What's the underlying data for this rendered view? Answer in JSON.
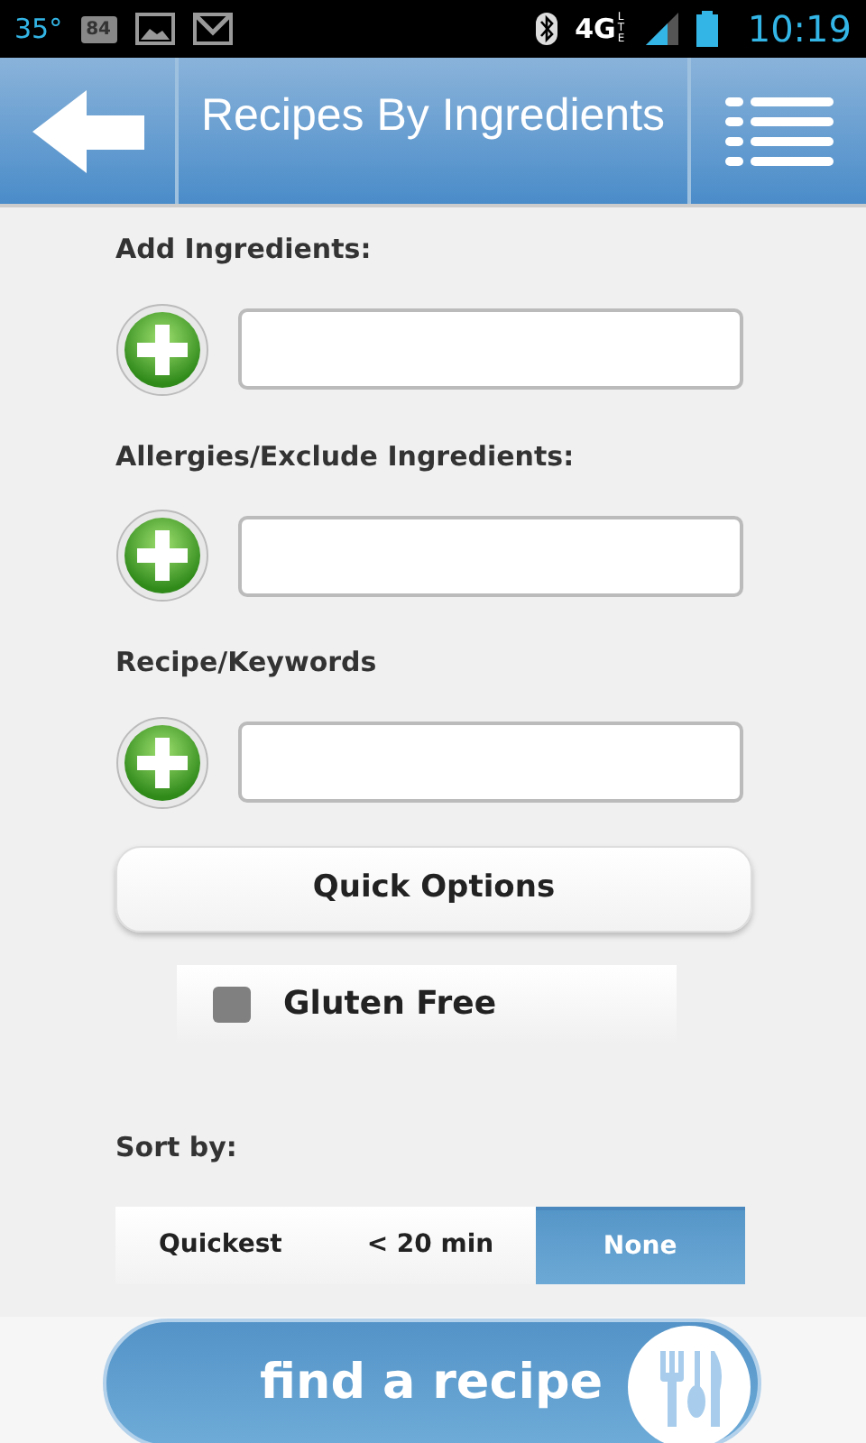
{
  "status_bar": {
    "temperature": "35°",
    "badge": "84",
    "network": "4G",
    "network_sub": "LTE",
    "time": "10:19"
  },
  "header": {
    "title": "Recipes By Ingredients"
  },
  "sections": [
    {
      "label": "Add Ingredients:"
    },
    {
      "label": "Allergies/Exclude Ingredients:"
    },
    {
      "label": "Recipe/Keywords"
    }
  ],
  "quick_options": {
    "label": "Quick Options",
    "options": [
      {
        "label": "Gluten Free",
        "checked": false
      }
    ]
  },
  "sort": {
    "label": "Sort by:",
    "options": [
      {
        "label": "Quickest",
        "selected": false
      },
      {
        "label": "< 20 min",
        "selected": false
      },
      {
        "label": "None",
        "selected": true
      }
    ]
  },
  "find_button": {
    "label": "find a recipe"
  }
}
